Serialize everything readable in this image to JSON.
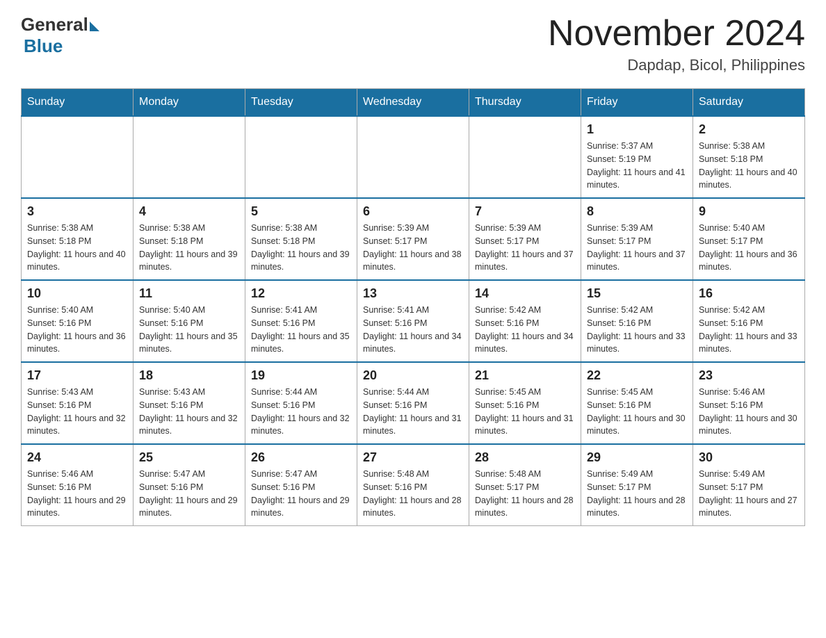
{
  "header": {
    "logo_general": "General",
    "logo_blue": "Blue",
    "month_title": "November 2024",
    "location": "Dapdap, Bicol, Philippines"
  },
  "calendar": {
    "days_of_week": [
      "Sunday",
      "Monday",
      "Tuesday",
      "Wednesday",
      "Thursday",
      "Friday",
      "Saturday"
    ],
    "weeks": [
      [
        {
          "day": "",
          "info": ""
        },
        {
          "day": "",
          "info": ""
        },
        {
          "day": "",
          "info": ""
        },
        {
          "day": "",
          "info": ""
        },
        {
          "day": "",
          "info": ""
        },
        {
          "day": "1",
          "info": "Sunrise: 5:37 AM\nSunset: 5:19 PM\nDaylight: 11 hours and 41 minutes."
        },
        {
          "day": "2",
          "info": "Sunrise: 5:38 AM\nSunset: 5:18 PM\nDaylight: 11 hours and 40 minutes."
        }
      ],
      [
        {
          "day": "3",
          "info": "Sunrise: 5:38 AM\nSunset: 5:18 PM\nDaylight: 11 hours and 40 minutes."
        },
        {
          "day": "4",
          "info": "Sunrise: 5:38 AM\nSunset: 5:18 PM\nDaylight: 11 hours and 39 minutes."
        },
        {
          "day": "5",
          "info": "Sunrise: 5:38 AM\nSunset: 5:18 PM\nDaylight: 11 hours and 39 minutes."
        },
        {
          "day": "6",
          "info": "Sunrise: 5:39 AM\nSunset: 5:17 PM\nDaylight: 11 hours and 38 minutes."
        },
        {
          "day": "7",
          "info": "Sunrise: 5:39 AM\nSunset: 5:17 PM\nDaylight: 11 hours and 37 minutes."
        },
        {
          "day": "8",
          "info": "Sunrise: 5:39 AM\nSunset: 5:17 PM\nDaylight: 11 hours and 37 minutes."
        },
        {
          "day": "9",
          "info": "Sunrise: 5:40 AM\nSunset: 5:17 PM\nDaylight: 11 hours and 36 minutes."
        }
      ],
      [
        {
          "day": "10",
          "info": "Sunrise: 5:40 AM\nSunset: 5:16 PM\nDaylight: 11 hours and 36 minutes."
        },
        {
          "day": "11",
          "info": "Sunrise: 5:40 AM\nSunset: 5:16 PM\nDaylight: 11 hours and 35 minutes."
        },
        {
          "day": "12",
          "info": "Sunrise: 5:41 AM\nSunset: 5:16 PM\nDaylight: 11 hours and 35 minutes."
        },
        {
          "day": "13",
          "info": "Sunrise: 5:41 AM\nSunset: 5:16 PM\nDaylight: 11 hours and 34 minutes."
        },
        {
          "day": "14",
          "info": "Sunrise: 5:42 AM\nSunset: 5:16 PM\nDaylight: 11 hours and 34 minutes."
        },
        {
          "day": "15",
          "info": "Sunrise: 5:42 AM\nSunset: 5:16 PM\nDaylight: 11 hours and 33 minutes."
        },
        {
          "day": "16",
          "info": "Sunrise: 5:42 AM\nSunset: 5:16 PM\nDaylight: 11 hours and 33 minutes."
        }
      ],
      [
        {
          "day": "17",
          "info": "Sunrise: 5:43 AM\nSunset: 5:16 PM\nDaylight: 11 hours and 32 minutes."
        },
        {
          "day": "18",
          "info": "Sunrise: 5:43 AM\nSunset: 5:16 PM\nDaylight: 11 hours and 32 minutes."
        },
        {
          "day": "19",
          "info": "Sunrise: 5:44 AM\nSunset: 5:16 PM\nDaylight: 11 hours and 32 minutes."
        },
        {
          "day": "20",
          "info": "Sunrise: 5:44 AM\nSunset: 5:16 PM\nDaylight: 11 hours and 31 minutes."
        },
        {
          "day": "21",
          "info": "Sunrise: 5:45 AM\nSunset: 5:16 PM\nDaylight: 11 hours and 31 minutes."
        },
        {
          "day": "22",
          "info": "Sunrise: 5:45 AM\nSunset: 5:16 PM\nDaylight: 11 hours and 30 minutes."
        },
        {
          "day": "23",
          "info": "Sunrise: 5:46 AM\nSunset: 5:16 PM\nDaylight: 11 hours and 30 minutes."
        }
      ],
      [
        {
          "day": "24",
          "info": "Sunrise: 5:46 AM\nSunset: 5:16 PM\nDaylight: 11 hours and 29 minutes."
        },
        {
          "day": "25",
          "info": "Sunrise: 5:47 AM\nSunset: 5:16 PM\nDaylight: 11 hours and 29 minutes."
        },
        {
          "day": "26",
          "info": "Sunrise: 5:47 AM\nSunset: 5:16 PM\nDaylight: 11 hours and 29 minutes."
        },
        {
          "day": "27",
          "info": "Sunrise: 5:48 AM\nSunset: 5:16 PM\nDaylight: 11 hours and 28 minutes."
        },
        {
          "day": "28",
          "info": "Sunrise: 5:48 AM\nSunset: 5:17 PM\nDaylight: 11 hours and 28 minutes."
        },
        {
          "day": "29",
          "info": "Sunrise: 5:49 AM\nSunset: 5:17 PM\nDaylight: 11 hours and 28 minutes."
        },
        {
          "day": "30",
          "info": "Sunrise: 5:49 AM\nSunset: 5:17 PM\nDaylight: 11 hours and 27 minutes."
        }
      ]
    ]
  }
}
